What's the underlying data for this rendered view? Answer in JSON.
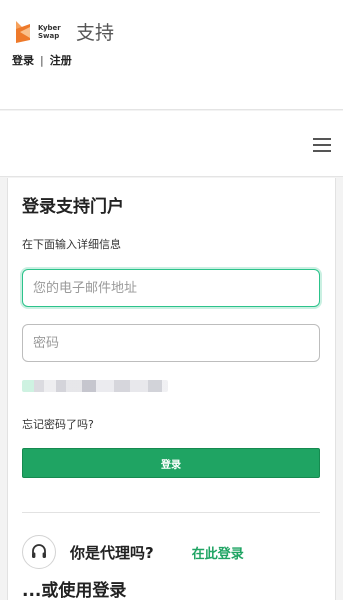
{
  "header": {
    "logo_text_line1": "Kyber",
    "logo_text_line2": "Swap",
    "title": "支持",
    "sign_in_link": "登录",
    "separator": "|",
    "register_link": "注册"
  },
  "navbar": {
    "menu_icon": "hamburger-menu-icon"
  },
  "login_form": {
    "title": "登录支持门户",
    "subtitle": "在下面输入详细信息",
    "email_placeholder": "您的电子邮件地址",
    "password_placeholder": "密码",
    "forgot_password": "忘记密码了吗?",
    "submit_label": "登录"
  },
  "agent_section": {
    "icon": "headset-icon",
    "question": "你是代理吗?",
    "link": "在此登录"
  },
  "alt_login": {
    "text": "...或使用登录"
  },
  "colors": {
    "accent": "#1fa463",
    "focus_border": "#2cc38b",
    "logo_orange": "#f08a3c"
  }
}
